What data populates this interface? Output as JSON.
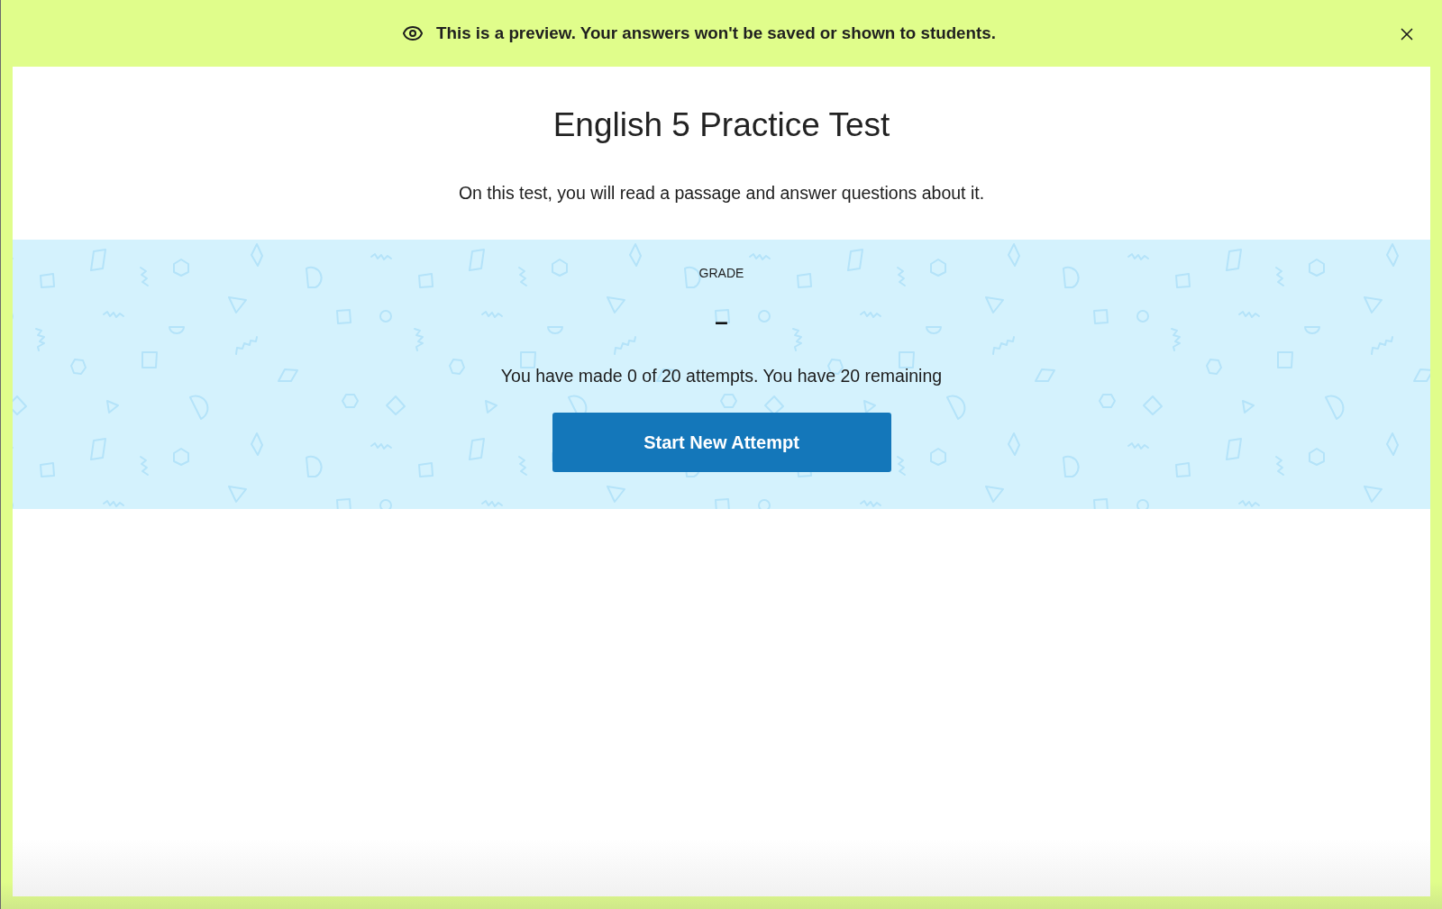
{
  "preview_banner": {
    "message": "This is a preview. Your answers won't be saved or shown to students."
  },
  "test": {
    "title": "English 5 Practice Test",
    "description": "On this test, you will read a passage and answer questions about it."
  },
  "grade_panel": {
    "label": "GRADE",
    "grade": "–",
    "attempts_text": "You have made 0 of 20 attempts. You have 20 remaining",
    "button": "Start New Attempt"
  }
}
